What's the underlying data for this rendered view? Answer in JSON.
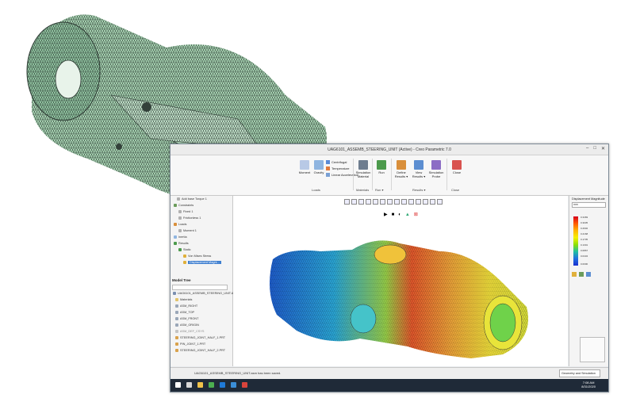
{
  "window": {
    "title": "UAG6101_ASSEMB_STEERING_UNIT (Active) - Creo Parametric 7.0",
    "controls": [
      "–",
      "□",
      "✕"
    ]
  },
  "ribbon": {
    "loads": {
      "moment": "Moment",
      "gravity": "Gravity",
      "centrifugal": "Centrifugal",
      "temperature": "Temperature",
      "linear_accel": "Linear Acceleration",
      "group": "Loads"
    },
    "materials": {
      "sim_material": "Simulation Material",
      "group": "Materials"
    },
    "run": {
      "run": "Run",
      "group": "Run ▾"
    },
    "results": {
      "define": "Define Results ▾",
      "view": "View Results ▾",
      "probe": "Simulation Probe",
      "group": "Results ▾"
    },
    "close": {
      "close": "Close",
      "group": "Close"
    }
  },
  "left_tree": {
    "items": [
      "Add base Torque 1",
      "Constraints",
      "Fixed 1",
      "Frictionless 1",
      "Loads",
      "Moment 1",
      "Inertia",
      "Results",
      "Static",
      "Von Mises Stress",
      "Displacement Magni..."
    ],
    "selected_index": 10
  },
  "model_tree": {
    "title": "Model Tree",
    "items": [
      "UAG6101_ASSEMB_STEERING_UNIT.ASM",
      "Materials",
      "ASM_RIGHT",
      "ASM_TOP",
      "ASM_FRONT",
      "ASM_ORIGIN",
      "ASM_DEF_CSYS",
      "STEERING_JOINT_HALF_1.PRT",
      "PIN_JOINT_1.PRT",
      "STEERING_JOINT_HALF_2.PRT"
    ]
  },
  "legend": {
    "title": "Displacement Magnitude",
    "unit": "mm",
    "ticks": [
      "0.3469",
      "0.3035",
      "0.2602",
      "0.2168",
      "0.1735",
      "0.1301",
      "0.0867",
      "0.0434",
      "0.0000"
    ]
  },
  "status": {
    "message": "UAG6101_ASSEMB_STEERING_UNIT.asm has been saved.",
    "mode": "Geometry and Simulation"
  },
  "taskbar": {
    "time": "7:08 AM",
    "date": "8/31/2020"
  },
  "colors": {
    "accent": "#3f7fd0",
    "mesh": "#9cc7a3"
  }
}
